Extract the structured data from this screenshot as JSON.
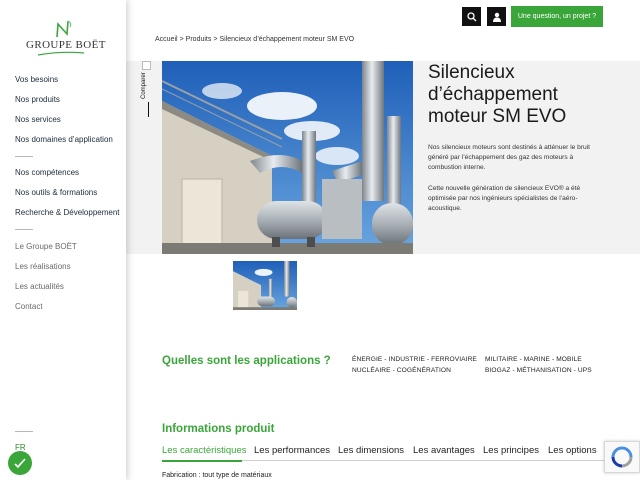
{
  "brand": {
    "logo_text": "GROUPE BOËT"
  },
  "sidebar": {
    "primary": [
      {
        "label": "Vos besoins"
      },
      {
        "label": "Nos produits"
      },
      {
        "label": "Nos services"
      },
      {
        "label": "Nos domaines d’application"
      }
    ],
    "secondary": [
      {
        "label": "Nos compétences"
      },
      {
        "label": "Nos outils & formations"
      },
      {
        "label": "Recherche & Développement"
      }
    ],
    "tertiary": [
      {
        "label": "Le Groupe BOËT"
      },
      {
        "label": "Les réalisations"
      },
      {
        "label": "Les actualités"
      },
      {
        "label": "Contact"
      }
    ],
    "language": "FR"
  },
  "header": {
    "contact_label": "Une question, un projet ?",
    "search_icon": "search-icon",
    "account_icon": "user-icon"
  },
  "breadcrumb": {
    "items": [
      "Accueil",
      "Produits",
      "Silencieux d’échappement moteur SM EVO"
    ],
    "separator": ">"
  },
  "compare": {
    "label": "Comparer"
  },
  "product": {
    "title": "Silencieux d’échappement moteur SM EVO",
    "description_1": "Nos silencieux moteurs sont destinés à atténuer le bruit généré par l’échappement des gaz des moteurs à combustion interne.",
    "description_2": "Cette nouvelle génération de silencieux EVO® a été optimisée par nos ingénieurs spécialistes de l’aéro-acoustique."
  },
  "applications": {
    "title": "Quelles sont les applications ?",
    "col1": [
      "ÉNERGIE - INDUSTRIE - FERROVIAIRE",
      "NUCLÉAIRE - COGÉNÉRATION"
    ],
    "col2": [
      "MILITAIRE - MARINE - MOBILE",
      "BIOGAZ - MÉTHANISATION - UPS"
    ]
  },
  "info": {
    "title": "Informations produit",
    "tabs": [
      "Les caractéristiques",
      "Les performances",
      "Les dimensions",
      "Les avantages",
      "Les principes",
      "Les options"
    ],
    "active_tab": 0,
    "first_line": "Fabrication : tout type de matériaux"
  },
  "colors": {
    "accent": "#3aa63a",
    "dark": "#111111",
    "band": "#f2f2f2"
  }
}
